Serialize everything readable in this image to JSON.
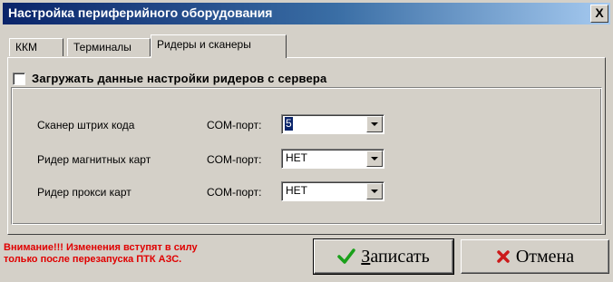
{
  "window": {
    "title": "Настройка периферийного оборудования",
    "close_label": "X"
  },
  "tabs": [
    {
      "label": "ККМ",
      "active": false
    },
    {
      "label": "Терминалы",
      "active": false
    },
    {
      "label": "Ридеры и сканеры",
      "active": true
    }
  ],
  "checkbox": {
    "label": "Загружать данные настройки ридеров с сервера",
    "checked": false
  },
  "devices": [
    {
      "label": "Сканер штрих кода",
      "port_label": "COM-порт:",
      "value": "5",
      "selected": true
    },
    {
      "label": "Ридер магнитных карт",
      "port_label": "COM-порт:",
      "value": "НЕТ",
      "selected": false
    },
    {
      "label": "Ридер прокси карт",
      "port_label": "COM-порт:",
      "value": "НЕТ",
      "selected": false
    }
  ],
  "warning": {
    "line1": "Внимание!!! Изменения вступят в силу",
    "line2": "только после перезапуска ПТК АЗС."
  },
  "buttons": {
    "save_accel": "З",
    "save_rest": "аписать",
    "cancel": "Отмена"
  },
  "colors": {
    "titlebar": "#0a246a",
    "warning": "#e00000",
    "save_icon": "#1aa01a",
    "cancel_icon": "#cc1a1a"
  },
  "icons": {
    "save": "check-icon",
    "cancel": "cross-icon",
    "combo": "chevron-down-icon"
  }
}
